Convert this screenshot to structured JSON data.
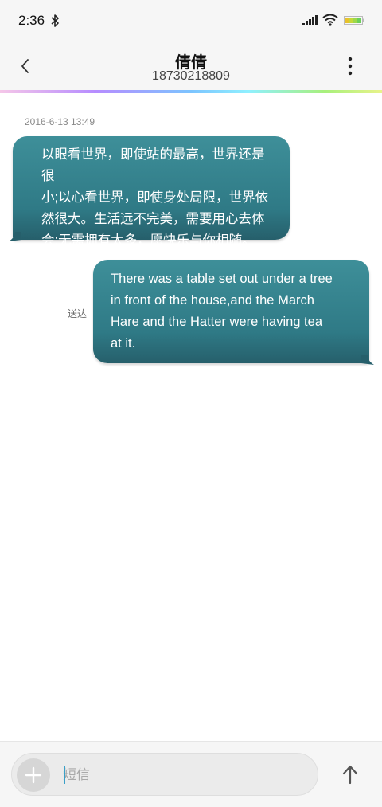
{
  "status_bar": {
    "time": "2:36",
    "icons": [
      "bluetooth-icon",
      "signal-icon",
      "wifi-icon",
      "battery-icon"
    ]
  },
  "header": {
    "contact_name": "倩倩",
    "phone_number": "18730218809",
    "back_icon": "chevron-left-icon",
    "more_icon": "more-vertical-icon"
  },
  "conversation": {
    "timestamp": "2016-6-13 13:49",
    "messages": [
      {
        "direction": "incoming",
        "lines": [
          "以眼看世界，即使站的最高，世界还是很",
          "小;以心看世界，即使身处局限，世界依",
          "然很大。生活远不完美，需要用心去体",
          "会;无需拥有太多，愿快乐与你相随。"
        ]
      },
      {
        "direction": "outgoing",
        "status": "送达",
        "lines": [
          "There was a table set out under a tree",
          "in front of the house,and the March",
          "Hare and the Hatter were having tea",
          "at it."
        ]
      }
    ]
  },
  "composer": {
    "placeholder": "短信",
    "value": "",
    "add_icon": "plus-icon",
    "send_icon": "arrow-up-icon"
  },
  "colors": {
    "bubble": "#2f7a86",
    "bar_background": "#f6f6f6",
    "caret": "#3aa0c8"
  }
}
